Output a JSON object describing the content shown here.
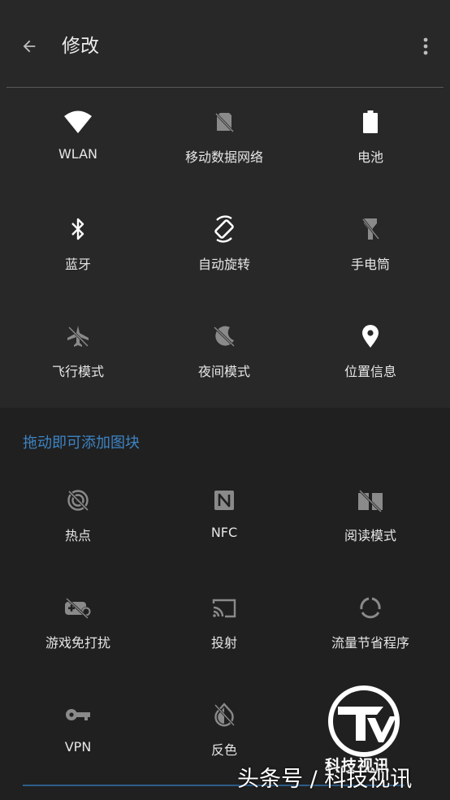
{
  "header": {
    "title": "修改",
    "back_icon": "arrow-back-icon",
    "more_icon": "more-vert-icon"
  },
  "active_tiles": [
    {
      "label": "WLAN",
      "icon": "wifi-icon"
    },
    {
      "label": "移动数据网络",
      "icon": "mobile-data-off-icon"
    },
    {
      "label": "电池",
      "icon": "battery-icon"
    },
    {
      "label": "蓝牙",
      "icon": "bluetooth-icon"
    },
    {
      "label": "自动旋转",
      "icon": "auto-rotate-icon"
    },
    {
      "label": "手电筒",
      "icon": "flashlight-off-icon"
    },
    {
      "label": "飞行模式",
      "icon": "airplane-off-icon"
    },
    {
      "label": "夜间模式",
      "icon": "night-mode-off-icon"
    },
    {
      "label": "位置信息",
      "icon": "location-icon"
    }
  ],
  "section_label": "拖动即可添加图块",
  "available_tiles": [
    {
      "label": "热点",
      "icon": "hotspot-off-icon"
    },
    {
      "label": "NFC",
      "icon": "nfc-icon"
    },
    {
      "label": "阅读模式",
      "icon": "reading-mode-off-icon"
    },
    {
      "label": "游戏免打扰",
      "icon": "game-dnd-icon"
    },
    {
      "label": "投射",
      "icon": "cast-icon"
    },
    {
      "label": "流量节省程序",
      "icon": "data-saver-icon"
    },
    {
      "label": "VPN",
      "icon": "vpn-key-icon"
    },
    {
      "label": "反色",
      "icon": "invert-colors-icon"
    }
  ],
  "watermark": {
    "logo_text": "科技视讯",
    "text": "头条号 / 科技视讯"
  },
  "colors": {
    "accent": "#3d84c4",
    "background": "#222222",
    "panel": "#282828",
    "icon_active": "#ffffff",
    "icon_inactive": "#8a8a8a"
  }
}
